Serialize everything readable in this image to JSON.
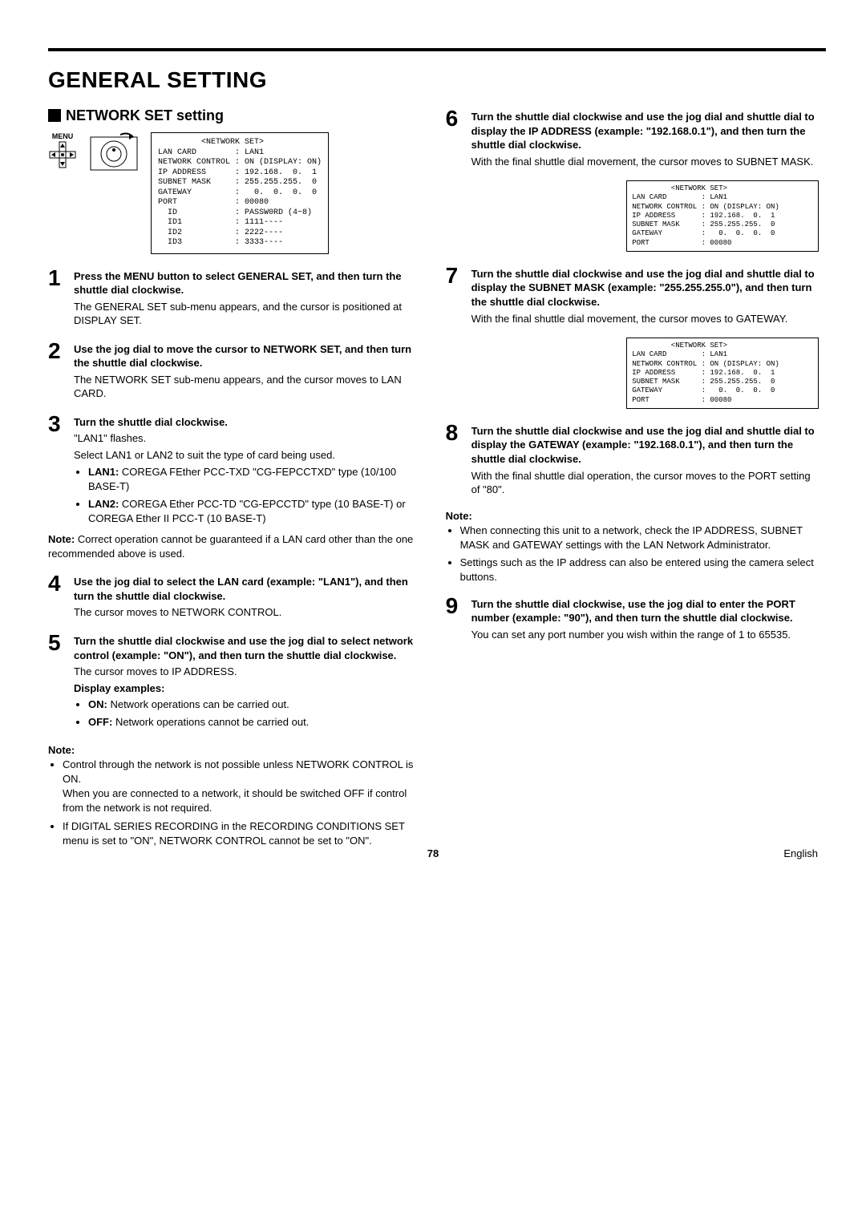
{
  "page": {
    "title": "GENERAL SETTING",
    "section": "NETWORK SET setting",
    "pageNumber": "78",
    "language": "English"
  },
  "icons": {
    "menuLabel": "MENU"
  },
  "screens": {
    "main": "         <NETWORK SET>\nLAN CARD        : LAN1\nNETWORK CONTROL : ON (DISPLAY: ON)\nIP ADDRESS      : 192.168.  0.  1\nSUBNET MASK     : 255.255.255.  0\nGATEWAY         :   0.  0.  0.  0\nPORT            : 00080\n  ID            : PASSW0RD (4~8)\n  ID1           : 1111----\n  ID2           : 2222----\n  ID3           : 3333----",
    "s6": "         <NETWORK SET>\nLAN CARD        : LAN1\nNETWORK CONTROL : ON (DISPLAY: ON)\nIP ADDRESS      : 192.168.  0.  1\nSUBNET MASK     : 255.255.255.  0\nGATEWAY         :   0.  0.  0.  0\nPORT            : 00080",
    "s7": "         <NETWORK SET>\nLAN CARD        : LAN1\nNETWORK CONTROL : ON (DISPLAY: ON)\nIP ADDRESS      : 192.168.  0.  1\nSUBNET MASK     : 255.255.255.  0\nGATEWAY         :   0.  0.  0.  0\nPORT            : 00080"
  },
  "steps": {
    "s1": {
      "num": "1",
      "lead": "Press the MENU button to select GENERAL SET, and then turn the shuttle dial clockwise.",
      "body": "The GENERAL SET sub-menu appears, and the cursor is positioned at DISPLAY SET."
    },
    "s2": {
      "num": "2",
      "lead": "Use the jog dial to move the cursor to NETWORK SET, and then turn the shuttle dial clockwise.",
      "body": "The NETWORK SET sub-menu appears, and the cursor moves to LAN CARD."
    },
    "s3": {
      "num": "3",
      "lead": "Turn the shuttle dial clockwise.",
      "l1": "\"LAN1\" flashes.",
      "l2": "Select LAN1 or LAN2 to suit the type of card being used.",
      "b1a": "LAN1:",
      "b1b": " COREGA FEther PCC-TXD \"CG-FEPCCTXD\" type (10/100 BASE-T)",
      "b2a": "LAN2:",
      "b2b": " COREGA Ether PCC-TD \"CG-EPCCTD\" type (10 BASE-T) or COREGA Ether II PCC-T (10 BASE-T)",
      "noteLead": "Note:",
      "noteBody": " Correct operation cannot be guaranteed if a LAN card other than the one recommended above is used."
    },
    "s4": {
      "num": "4",
      "lead": "Use the jog dial to select the LAN card (example: \"LAN1\"), and then turn the shuttle dial clockwise.",
      "body": "The cursor moves to NETWORK CONTROL."
    },
    "s5": {
      "num": "5",
      "lead": "Turn the shuttle dial clockwise and use the jog dial to select network control (example: \"ON\"), and then turn the shuttle dial clockwise.",
      "body": "The cursor moves to IP ADDRESS.",
      "disp": "Display examples:",
      "on": "ON:",
      "onBody": " Network operations can be carried out.",
      "off": "OFF:",
      "offBody": " Network operations cannot be carried out."
    },
    "noteA": {
      "label": "Note:",
      "b1": "Control through the network is not possible unless NETWORK CONTROL is ON.",
      "b1b": "When you are connected to a network, it should be switched OFF if control from the network is not required.",
      "b2": "If DIGITAL SERIES RECORDING in the RECORDING CONDITIONS SET menu is set to \"ON\", NETWORK CONTROL cannot be set to \"ON\"."
    },
    "s6": {
      "num": "6",
      "lead": "Turn the shuttle dial clockwise and use the jog dial and shuttle dial to display the IP ADDRESS (example: \"192.168.0.1\"), and then turn the shuttle dial clockwise.",
      "body": "With the final shuttle dial movement, the cursor moves to SUBNET MASK."
    },
    "s7": {
      "num": "7",
      "lead": "Turn the shuttle dial clockwise and use the jog dial and shuttle dial to display the SUBNET MASK (example: \"255.255.255.0\"), and then turn the shuttle dial clockwise.",
      "body": "With the final shuttle dial movement, the cursor moves to GATEWAY."
    },
    "s8": {
      "num": "8",
      "lead": "Turn the shuttle dial clockwise and use the jog dial and shuttle dial to display the GATEWAY (example: \"192.168.0.1\"), and then turn the shuttle dial clockwise.",
      "body": "With the final shuttle dial operation, the cursor moves to the PORT setting of \"80\"."
    },
    "noteB": {
      "label": "Note:",
      "b1": "When connecting this unit to a network, check the IP ADDRESS, SUBNET MASK and GATEWAY settings with the LAN Network Administrator.",
      "b2": "Settings such as the IP address can also be entered using the camera select buttons."
    },
    "s9": {
      "num": "9",
      "lead": "Turn the shuttle dial clockwise, use the jog dial to enter the PORT number (example: \"90\"), and then turn the shuttle dial clockwise.",
      "body": "You can set any port number you wish within the range of 1 to 65535."
    }
  }
}
